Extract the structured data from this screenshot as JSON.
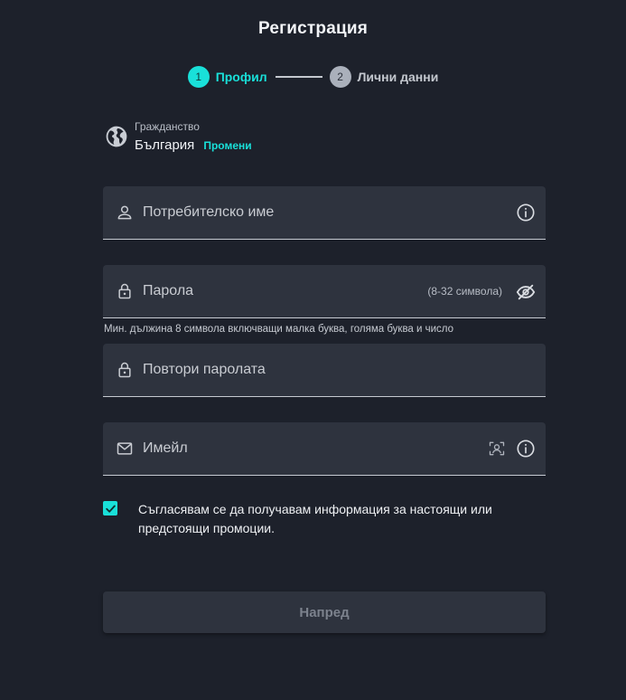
{
  "title": "Регистрация",
  "steps": [
    {
      "number": "1",
      "label": "Профил",
      "state": "active"
    },
    {
      "number": "2",
      "label": "Лични данни",
      "state": "inactive"
    }
  ],
  "citizenship": {
    "label": "Гражданство",
    "value": "България",
    "change_link": "Промени"
  },
  "fields": {
    "username": {
      "label": "Потребителско име"
    },
    "password": {
      "label": "Парола",
      "hint": "(8-32 символа)",
      "helper": "Мин. дължина 8 символа включващи малка буква, голяма буква и число"
    },
    "repeat_password": {
      "label": "Повтори паролата"
    },
    "email": {
      "label": "Имейл"
    }
  },
  "consent": {
    "checked": true,
    "text": "Съгласявам се да получавам информация за настоящи или предстоящи промоции."
  },
  "next_button": {
    "label": "Напред",
    "state": "disabled"
  },
  "colors": {
    "background": "#1d212b",
    "field": "#2e333e",
    "accent": "#19e0d9",
    "text": "#e9ebef",
    "muted": "#c9ccd2",
    "disabled_text": "#7c828d"
  },
  "icons": {
    "citizenship": "globe-icon",
    "username": "user-icon",
    "username_action": "info-icon",
    "password": "lock-icon",
    "password_action": "eye-off-icon",
    "repeat_password": "lock-icon",
    "email": "mail-icon",
    "email_action_1": "contact-picker-icon",
    "email_action_2": "info-icon",
    "consent": "checkmark-icon"
  }
}
